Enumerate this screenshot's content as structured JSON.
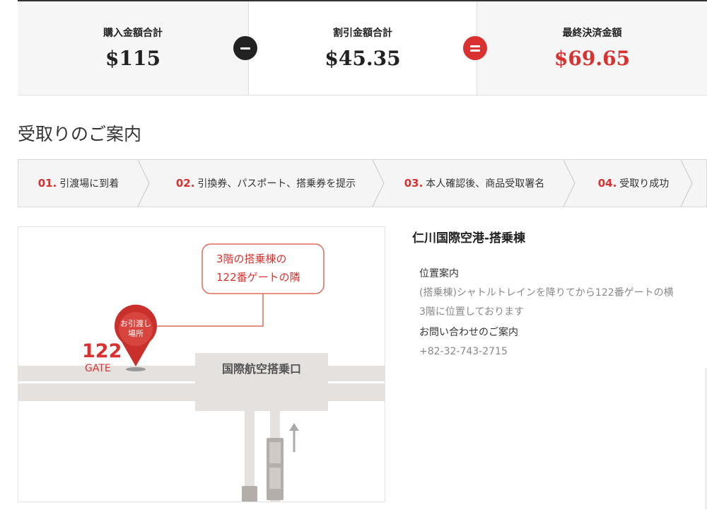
{
  "summary": {
    "purchase_label": "購入金額合計",
    "purchase_value": "$115",
    "discount_label": "割引金額合計",
    "discount_value": "$45.35",
    "final_label": "最終決済金額",
    "final_value": "$69.65"
  },
  "section_title": "受取りのご案内",
  "steps": [
    {
      "num": "01.",
      "label": "引渡場に到着"
    },
    {
      "num": "02.",
      "label": "引換券、パスポート、搭乗券を提示"
    },
    {
      "num": "03.",
      "label": "本人確認後、商品受取署名"
    },
    {
      "num": "04.",
      "label": "受取り成功"
    }
  ],
  "map": {
    "callout_line1": "3階の搭乗棟の",
    "callout_line2": "122番ゲートの隣",
    "pin_line1": "お引渡し",
    "pin_line2": "場所",
    "gate_number": "122",
    "gate_label": "GATE",
    "boarding_label": "国際航空搭乗口"
  },
  "info": {
    "title": "仁川国際空港-搭乗棟",
    "location_label": "位置案内",
    "location_line1": "(搭乗棟)シャトルトレインを降りてから122番ゲートの横",
    "location_line2": "3階に位置しております",
    "contact_label": "お問い合わせのご案内",
    "contact_phone": "+82-32-743-2715"
  },
  "colors": {
    "accent": "#d8312f",
    "dark": "#222222"
  }
}
